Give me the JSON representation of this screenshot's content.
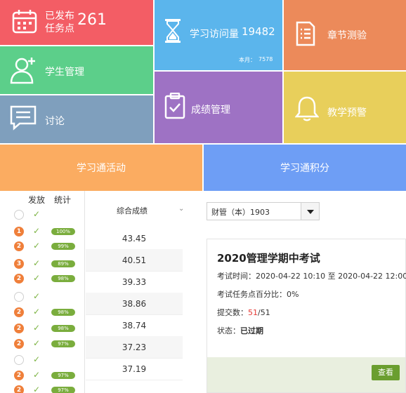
{
  "tiles": {
    "published": {
      "label_line1": "已发布",
      "label_line2": "任务点",
      "count": "261"
    },
    "visits": {
      "label": "学习访问量",
      "count": "19482",
      "month_label": "本月：",
      "month_value": "7578"
    },
    "chapter": {
      "label": "章节测验"
    },
    "students": {
      "label": "学生管理"
    },
    "grades": {
      "label": "成绩管理"
    },
    "alert": {
      "label": "教学预警"
    },
    "discuss": {
      "label": "讨论"
    },
    "activity": {
      "label": "学习通活动"
    },
    "points": {
      "label": "学习通积分"
    }
  },
  "list": {
    "headers": {
      "publish": "发放",
      "stats": "统计",
      "score": "综合成绩"
    },
    "rows": [
      {
        "badge": "",
        "pill": ""
      },
      {
        "badge": "1",
        "pill": "100%"
      },
      {
        "badge": "2",
        "pill": "99%"
      },
      {
        "badge": "3",
        "pill": "89%"
      },
      {
        "badge": "2",
        "pill": "98%"
      },
      {
        "badge": "",
        "pill": ""
      },
      {
        "badge": "2",
        "pill": "98%"
      },
      {
        "badge": "2",
        "pill": "98%"
      },
      {
        "badge": "2",
        "pill": "97%"
      },
      {
        "badge": "",
        "pill": ""
      },
      {
        "badge": "2",
        "pill": "97%"
      },
      {
        "badge": "2",
        "pill": "97%"
      }
    ],
    "scores": [
      "43.45",
      "40.51",
      "39.33",
      "38.86",
      "38.74",
      "37.23",
      "37.19"
    ]
  },
  "class_select": {
    "value": "财管（本）1903"
  },
  "exam": {
    "title": "2020管理学期中考试",
    "time_label": "考试时间：",
    "time_start": "2020-04-22 10:10",
    "time_sep": "至",
    "time_end": "2020-04-22 12:00",
    "task_label": "考试任务点百分比：",
    "task_value": "0%",
    "submit_label": "提交数：",
    "submit_done": "51",
    "submit_total": "/51",
    "status_label": "状态：",
    "status_value": "已过期",
    "view_button": "查看"
  },
  "colors": {
    "published": "#f35d65",
    "visits": "#5bb5ec",
    "chapter": "#ec8a5a",
    "students": "#5ccf8a",
    "grades": "#9e72c4",
    "alert": "#e8cf5b",
    "discuss": "#7f9fbd",
    "activity": "#fbac61",
    "points": "#6e9ef5",
    "badge": "#ef7f3a",
    "pill": "#7aad3d",
    "view_button": "#6a9e2f"
  }
}
